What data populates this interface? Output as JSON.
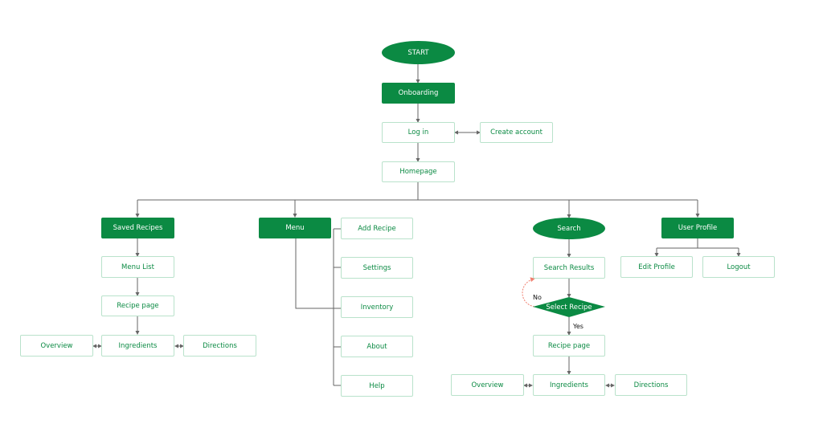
{
  "diagram": {
    "start": "START",
    "onboarding": "Onboarding",
    "login": "Log in",
    "create_account": "Create account",
    "homepage": "Homepage",
    "saved_recipes": {
      "title": "Saved Recipes",
      "menu_list": "Menu List",
      "recipe_page": "Recipe page",
      "overview": "Overview",
      "ingredients": "Ingredients",
      "directions": "Directions"
    },
    "menu": {
      "title": "Menu",
      "items": [
        "Add Recipe",
        "Settings",
        "Inventory",
        "About",
        "Help"
      ]
    },
    "search": {
      "title": "Search",
      "results": "Search Results",
      "decision": "Select Recipe",
      "no_label": "No",
      "yes_label": "Yes",
      "recipe_page": "Recipe page",
      "overview": "Overview",
      "ingredients": "Ingredients",
      "directions": "Directions"
    },
    "user_profile": {
      "title": "User Profile",
      "edit_profile": "Edit Profile",
      "logout": "Logout"
    }
  },
  "colors": {
    "primary": "#0b8a43",
    "outline": "#b9e2cb",
    "connector": "#666666",
    "loop_arrow": "#f08070"
  }
}
